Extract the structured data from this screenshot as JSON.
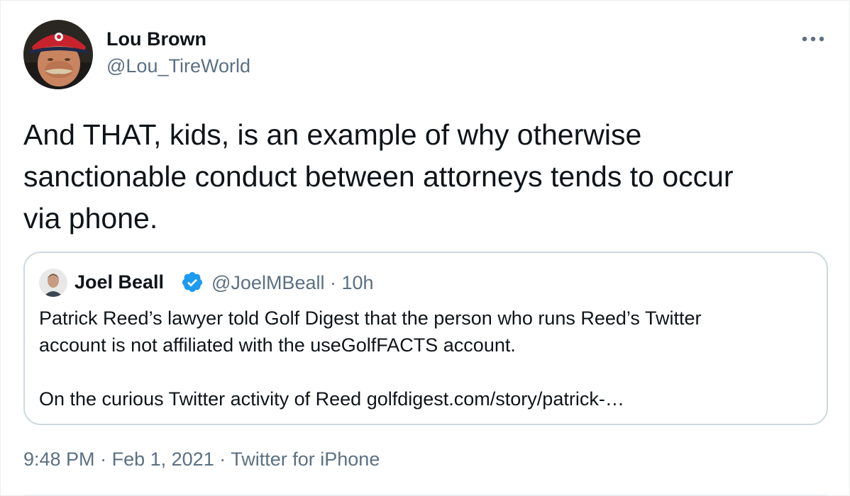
{
  "tweet": {
    "author": {
      "display_name": "Lou Brown",
      "handle": "@Lou_TireWorld",
      "avatar_icon": "avatar-photo"
    },
    "more_icon": "more-icon",
    "text_lines": [
      "And THAT, kids, is an example of why otherwise",
      "sanctionable conduct between attorneys tends to occur",
      "via phone."
    ],
    "quote": {
      "display_name": "Joel Beall",
      "verified_icon": "verified-badge-icon",
      "handle": "@JoelMBeall",
      "separator": "·",
      "time_ago": "10h",
      "text_lines": [
        "Patrick Reed’s lawyer told Golf Digest that the person who runs Reed’s Twitter",
        "account is not affiliated with the useGolfFACTS account.",
        "On the curious Twitter activity of Reed golfdigest.com/story/patrick-…"
      ]
    },
    "footer": {
      "time": "9:48 PM",
      "separator": "·",
      "date": "Feb 1, 2021",
      "source": "Twitter for iPhone"
    }
  },
  "colors": {
    "text_primary": "#0f1419",
    "text_secondary": "#5b7083",
    "border": "#cfd9de",
    "verified_blue": "#1d9bf0"
  }
}
